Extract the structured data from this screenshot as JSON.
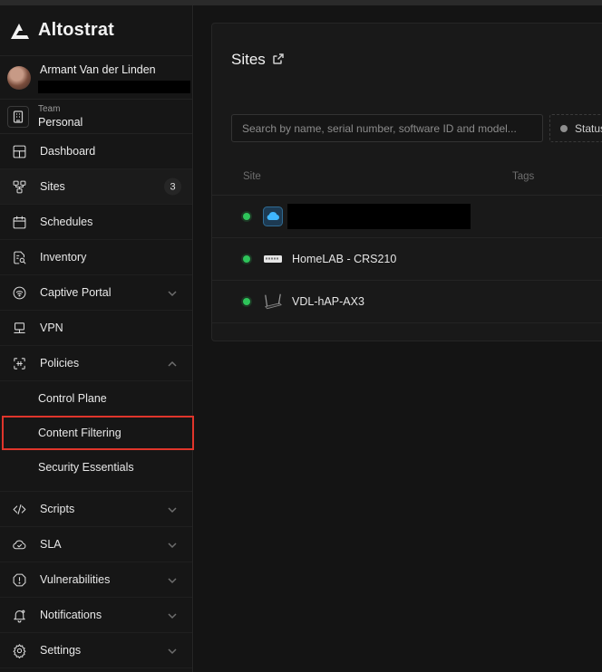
{
  "app": {
    "name": "Altostrat"
  },
  "user": {
    "name": "Armant Van der Linden"
  },
  "team": {
    "caption": "Team",
    "name": "Personal"
  },
  "nav": {
    "dashboard": "Dashboard",
    "sites": "Sites",
    "sites_count": "3",
    "schedules": "Schedules",
    "inventory": "Inventory",
    "captive_portal": "Captive Portal",
    "vpn": "VPN",
    "policies": "Policies",
    "policies_sub": {
      "control_plane": "Control Plane",
      "content_filtering": "Content Filtering",
      "security_essentials": "Security Essentials"
    },
    "scripts": "Scripts",
    "sla": "SLA",
    "vulnerabilities": "Vulnerabilities",
    "notifications": "Notifications",
    "settings": "Settings"
  },
  "page": {
    "title": "Sites",
    "search_placeholder": "Search by name, serial number, software ID and model...",
    "status_filter": "Status",
    "columns": {
      "site": "Site",
      "tags": "Tags"
    },
    "rows": [
      {
        "name": "",
        "icon": "cloud-icon",
        "status": "online"
      },
      {
        "name": "HomeLAB - CRS210",
        "icon": "switch-icon",
        "status": "online"
      },
      {
        "name": "VDL-hAP-AX3",
        "icon": "router-icon",
        "status": "online"
      }
    ]
  },
  "colors": {
    "accent_selected_outline": "#e0352b",
    "status_online": "#2ec45a"
  }
}
